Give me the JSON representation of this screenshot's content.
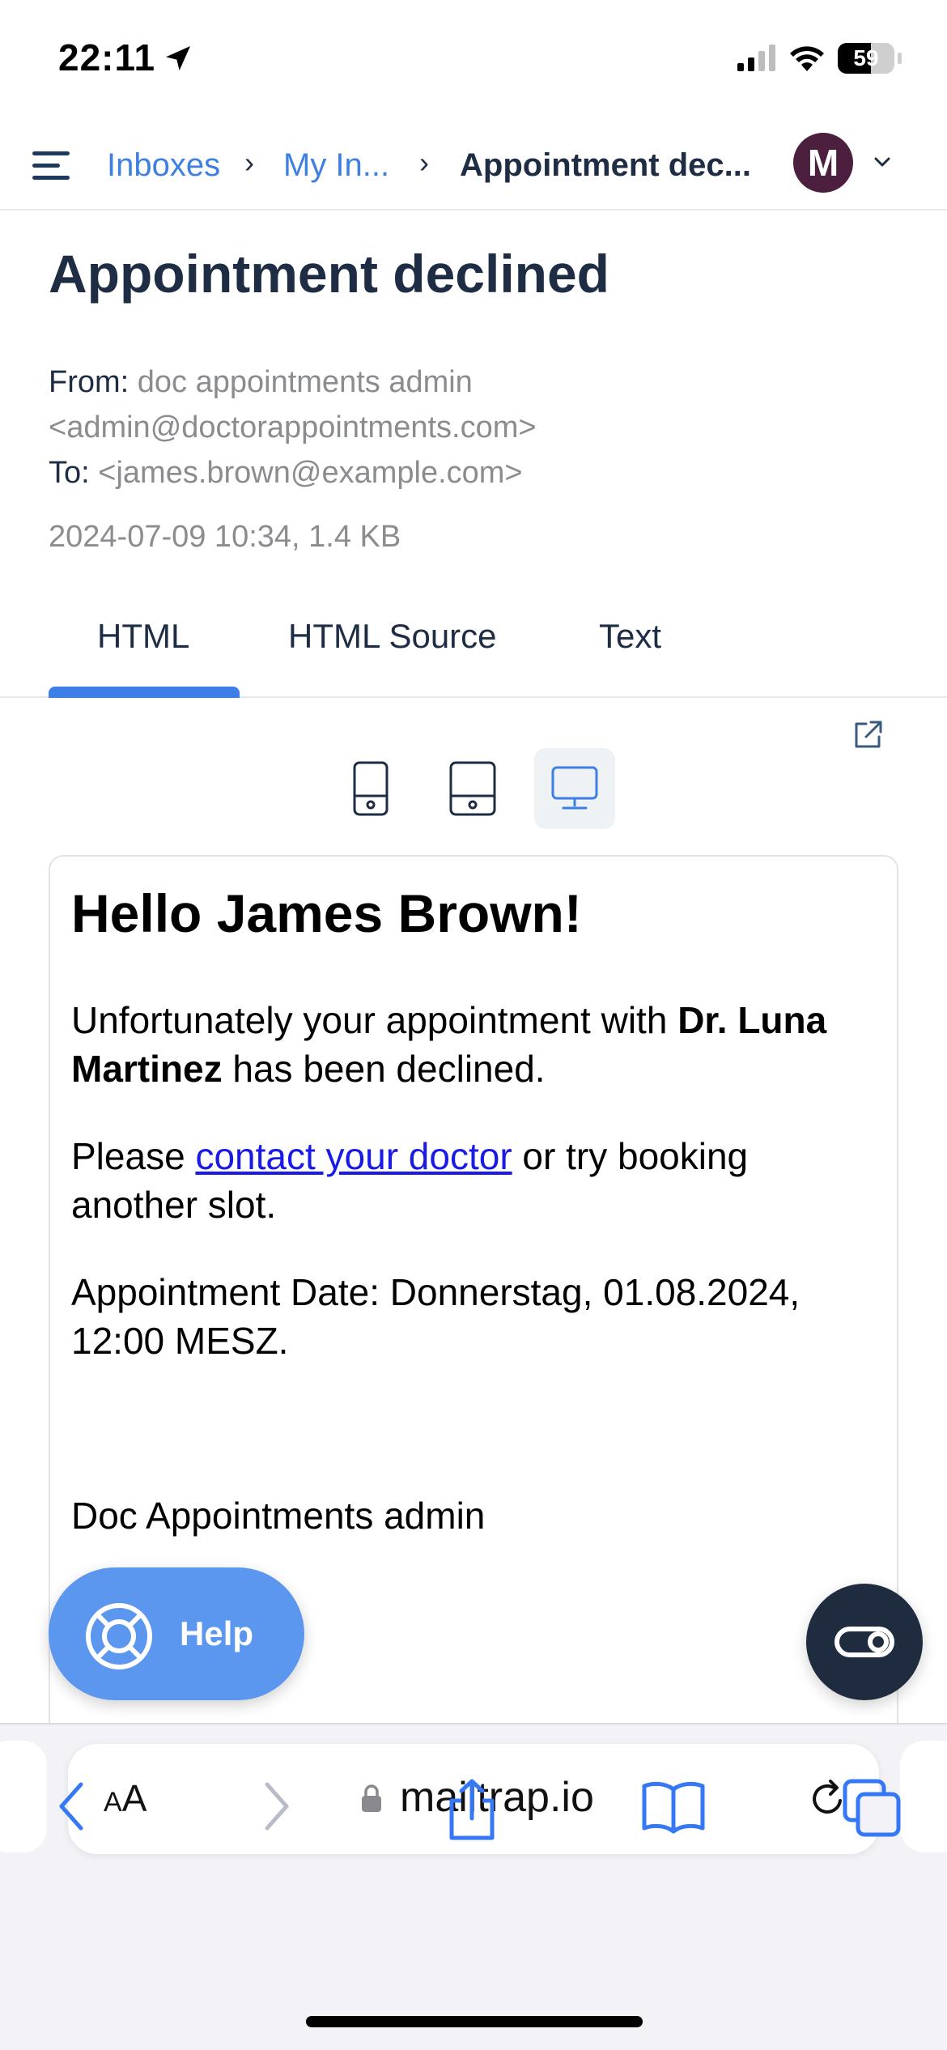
{
  "status_bar": {
    "time": "22:11",
    "battery": "59"
  },
  "nav": {
    "crumbs": [
      "Inboxes",
      "My In...",
      "Appointment dec..."
    ],
    "avatar_letter": "M"
  },
  "message": {
    "subject": "Appointment declined",
    "from_label": "From:",
    "from_name": "doc appointments admin",
    "from_email": "<admin@doctorappointments.com>",
    "to_label": "To:",
    "to_email": "<james.brown@example.com>",
    "date_size": "2024-07-09 10:34, 1.4 KB"
  },
  "tabs": [
    {
      "label": "HTML",
      "active": true
    },
    {
      "label": "HTML Source",
      "active": false
    },
    {
      "label": "Text",
      "active": false
    }
  ],
  "preview_devices": [
    "mobile",
    "tablet",
    "desktop"
  ],
  "preview_active_device": "desktop",
  "email": {
    "greeting": "Hello James Brown!",
    "p1_a": "Unfortunately your appointment with ",
    "p1_bold": "Dr. Luna Martinez",
    "p1_b": " has been declined.",
    "p2_a": "Please ",
    "p2_link": "contact your doctor",
    "p2_b": " or try booking another slot.",
    "p3": "Appointment Date: Donnerstag, 01.08.2024, 12:00 MESZ.",
    "signature": "Doc Appointments admin"
  },
  "help_button": {
    "label": "Help"
  },
  "browser": {
    "aa_small": "A",
    "aa_large": "A",
    "url": "mailtrap.io"
  },
  "colors": {
    "link_blue": "#3f7fe0",
    "tab_accent": "#3d7fe6",
    "help_blue": "#5b96ef",
    "avatar": "#4b1f3d"
  }
}
